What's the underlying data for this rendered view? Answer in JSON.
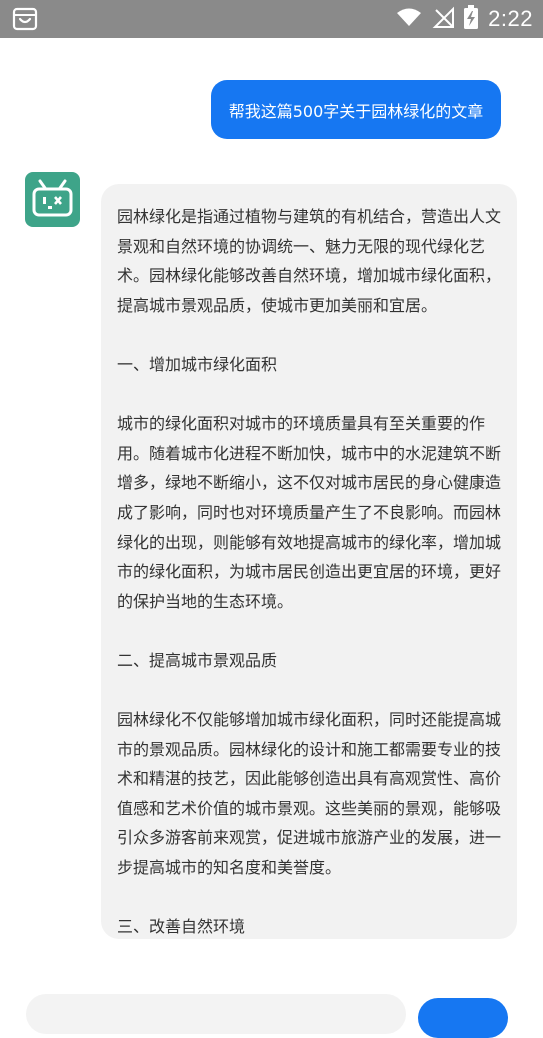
{
  "status_bar": {
    "time": "2:22",
    "left_icon": "notification-bag-icon",
    "icons": [
      "wifi-icon",
      "no-signal-icon",
      "battery-charging-icon"
    ]
  },
  "chat": {
    "user_message": "帮我这篇500字关于园林绿化的文章",
    "bot_avatar_icon": "robot-icon",
    "bot_paragraphs": [
      "园林绿化是指通过植物与建筑的有机结合，营造出人文景观和自然环境的协调统一、魅力无限的现代绿化艺术。园林绿化能够改善自然环境，增加城市绿化面积，提高城市景观品质，使城市更加美丽和宜居。",
      "一、增加城市绿化面积",
      "城市的绿化面积对城市的环境质量具有至关重要的作用。随着城市化进程不断加快，城市中的水泥建筑不断增多，绿地不断缩小，这不仅对城市居民的身心健康造成了影响，同时也对环境质量产生了不良影响。而园林绿化的出现，则能够有效地提高城市的绿化率，增加城市的绿化面积，为城市居民创造出更宜居的环境，更好的保护当地的生态环境。",
      "二、提高城市景观品质",
      "园林绿化不仅能够增加城市绿化面积，同时还能提高城市的景观品质。园林绿化的设计和施工都需要专业的技术和精湛的技艺，因此能够创造出具有高观赏性、高价值感和艺术价值的城市景观。这些美丽的景观，能够吸引众多游客前来观赏，促进城市旅游产业的发展，进一步提高城市的知名度和美誉度。",
      "三、改善自然环境"
    ]
  },
  "colors": {
    "status_bar_bg": "#8a8a8a",
    "user_bubble": "#1677f2",
    "bot_bubble": "#f2f2f2",
    "avatar": "#3ea489",
    "text": "#333333"
  }
}
